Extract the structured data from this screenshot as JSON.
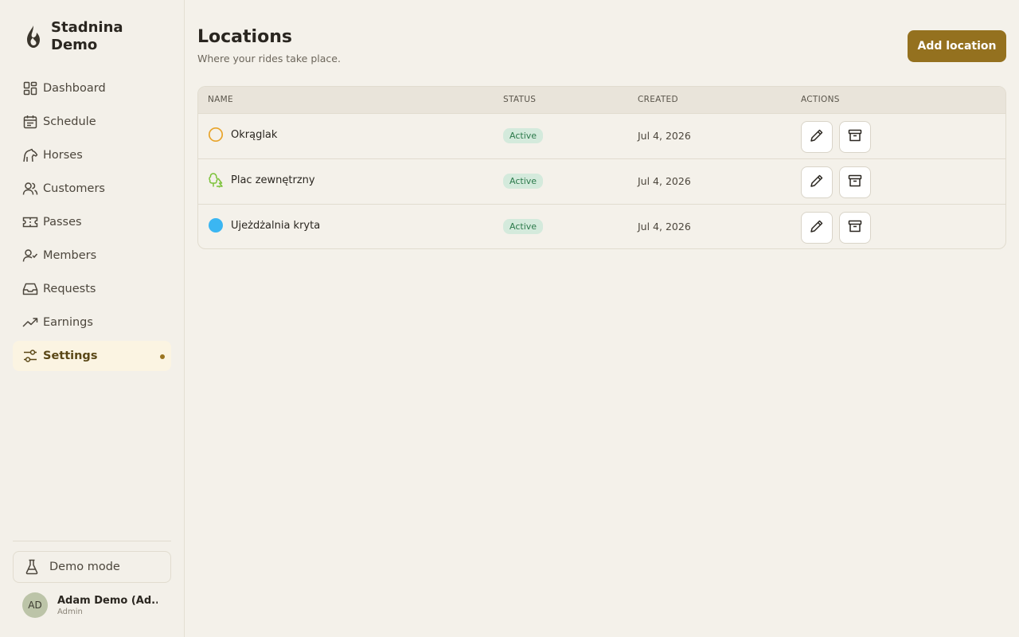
{
  "brand": {
    "name": "Stadnina Demo"
  },
  "sidebar": {
    "items": [
      {
        "label": "Dashboard",
        "icon": "dashboard-icon"
      },
      {
        "label": "Schedule",
        "icon": "calendar-icon"
      },
      {
        "label": "Horses",
        "icon": "horse-icon"
      },
      {
        "label": "Customers",
        "icon": "users-icon"
      },
      {
        "label": "Passes",
        "icon": "ticket-icon"
      },
      {
        "label": "Members",
        "icon": "user-check-icon"
      },
      {
        "label": "Requests",
        "icon": "inbox-icon"
      },
      {
        "label": "Earnings",
        "icon": "trending-up-icon"
      },
      {
        "label": "Settings",
        "icon": "sliders-icon",
        "active": true
      }
    ],
    "demo_mode_label": "Demo mode",
    "user": {
      "initials": "AD",
      "name": "Adam Demo (Ad...",
      "role": "Admin"
    }
  },
  "header": {
    "title": "Locations",
    "subtitle": "Where your rides take place.",
    "add_button_label": "Add location"
  },
  "table": {
    "columns": [
      "NAME",
      "STATUS",
      "CREATED",
      "ACTIONS"
    ],
    "rows": [
      {
        "name": "Okrąglak",
        "icon": "ring-circle-icon",
        "icon_color": "#e8a42a",
        "status": "Active",
        "created": "Jul 4, 2026"
      },
      {
        "name": "Plac zewnętrzny",
        "icon": "trees-icon",
        "icon_color": "#7cc23a",
        "status": "Active",
        "created": "Jul 4, 2026"
      },
      {
        "name": "Ujeżdżalnia kryta",
        "icon": "filled-circle-icon",
        "icon_color": "#3bb6f2",
        "status": "Active",
        "created": "Jul 4, 2026"
      }
    ]
  },
  "colors": {
    "accent": "#94711f",
    "status_bg": "#d4eadc",
    "status_text": "#2c7a4b",
    "background": "#f4f1ea"
  }
}
